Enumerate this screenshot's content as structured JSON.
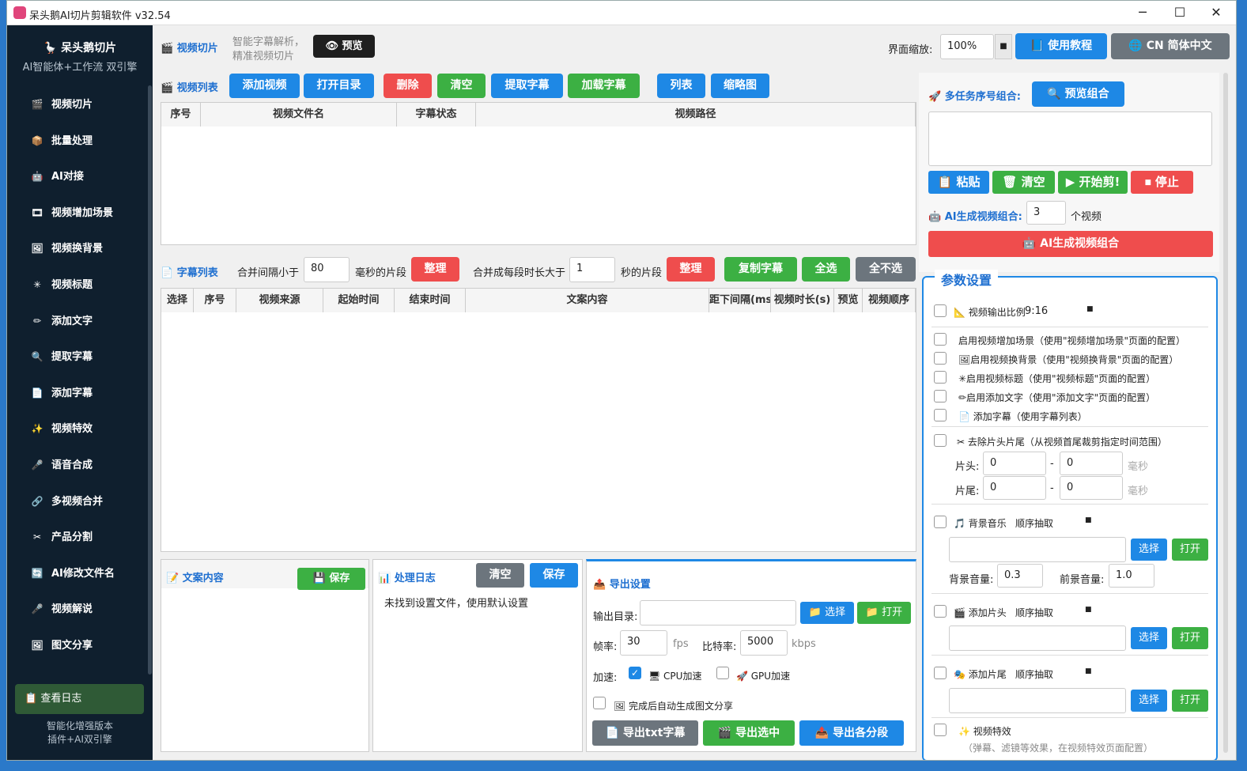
{
  "window": {
    "title": "呆头鹅AI切片剪辑软件 v32.54",
    "min": "─",
    "max": "☐",
    "close": "✕"
  },
  "sidebar": {
    "brand": "🪿 呆头鹅切片",
    "subtitle": "AI智能体+工作流 双引擎",
    "items": [
      {
        "icon": "🎬",
        "label": "视频切片"
      },
      {
        "icon": "📦",
        "label": "批量处理"
      },
      {
        "icon": "🤖",
        "label": "AI对接"
      },
      {
        "icon": "🎞",
        "label": "视频增加场景"
      },
      {
        "icon": "🖼",
        "label": "视频换背景"
      },
      {
        "icon": "✳",
        "label": "视频标题"
      },
      {
        "icon": "✏",
        "label": "添加文字"
      },
      {
        "icon": "🔍",
        "label": "提取字幕"
      },
      {
        "icon": "📄",
        "label": "添加字幕"
      },
      {
        "icon": "✨",
        "label": "视频特效"
      },
      {
        "icon": "🎤",
        "label": "语音合成"
      },
      {
        "icon": "🔗",
        "label": "多视频合并"
      },
      {
        "icon": "✂",
        "label": "产品分割"
      },
      {
        "icon": "🔄",
        "label": "AI修改文件名"
      },
      {
        "icon": "🎤",
        "label": "视频解说"
      },
      {
        "icon": "🖼",
        "label": "图文分享"
      }
    ],
    "view_log": "📋 查看日志",
    "footer1": "智能化增强版本",
    "footer2": "插件+AI双引擎"
  },
  "header": {
    "section": "🎬 视频切片",
    "desc1": "智能字幕解析，",
    "desc2": "精准视频切片",
    "preview": "👁 预览",
    "zoom_label": "界面缩放:",
    "zoom_value": "100%",
    "tutorial": "📘 使用教程",
    "language": "🌐 CN 简体中文"
  },
  "video_list": {
    "title": "🎬 视频列表",
    "buttons": [
      "添加视频",
      "打开目录",
      "删除",
      "清空",
      "提取字幕",
      "加载字幕",
      "列表",
      "缩略图"
    ],
    "columns": [
      "序号",
      "视频文件名",
      "字幕状态",
      "视频路径"
    ]
  },
  "subtitle_list": {
    "title": "📄 字幕列表",
    "merge_gap_label": "合并间隔小于",
    "merge_gap_value": "80",
    "ms_segment": "毫秒的片段",
    "tidy1": "整理",
    "merge_dur_label": "合并成每段时长大于",
    "merge_dur_value": "1",
    "sec_segment": "秒的片段",
    "tidy2": "整理",
    "copy": "复制字幕",
    "select_all": "全选",
    "select_none": "全不选",
    "columns": [
      "选择",
      "序号",
      "视频来源",
      "起始时间",
      "结束时间",
      "文案内容",
      "距下间隔(ms)",
      "视频时长(s)",
      "预览",
      "视频顺序"
    ]
  },
  "copy_panel": {
    "title": "📝 文案内容",
    "save": "💾 保存"
  },
  "log_panel": {
    "title": "📊 处理日志",
    "clear": "清空",
    "save": "保存",
    "message": "未找到设置文件，使用默认设置"
  },
  "export": {
    "title": "📤 导出设置",
    "dir_label": "输出目录:",
    "dir_value": "",
    "choose": "📁 选择",
    "open": "📁 打开",
    "fps_label": "帧率:",
    "fps_value": "30",
    "fps_unit": "fps",
    "bitrate_label": "比特率:",
    "bitrate_value": "5000",
    "bitrate_unit": "kbps",
    "accel_label": "加速:",
    "cpu": "🖥 CPU加速",
    "gpu": "🚀 GPU加速",
    "auto_share": "🖼 完成后自动生成图文分享",
    "btn_txt": "📄 导出txt字幕",
    "btn_selected": "🎬 导出选中",
    "btn_segments": "📤 导出各分段"
  },
  "right": {
    "multi_title": "🚀 多任务序号组合:",
    "preview_combo": "🔍 预览组合",
    "paste": "📋 粘贴",
    "clear": "🗑 清空",
    "start": "▶ 开始剪!",
    "stop": "⏹ 停止",
    "ai_label": "🤖 AI生成视频组合:",
    "ai_count": "3",
    "ai_unit": "个视频",
    "ai_btn": "🤖 AI生成视频组合",
    "params_title": "参数设置",
    "ratio_label": "📐 视频输出比例",
    "ratio_value": "9:16",
    "opt1": "启用视频增加场景（使用\"视频增加场景\"页面的配置）",
    "opt2": "🖼启用视频换背景（使用\"视频换背景\"页面的配置）",
    "opt3": "✳启用视频标题（使用\"视频标题\"页面的配置）",
    "opt4": "✏启用添加文字（使用\"添加文字\"页面的配置）",
    "opt5": "📄 添加字幕（使用字幕列表）",
    "trim": "✂ 去除片头片尾（从视频首尾裁剪指定时间范围）",
    "head_label": "片头:",
    "tail_label": "片尾:",
    "zero": "0",
    "dash": "-",
    "ms": "毫秒",
    "bgm": "🎵 背景音乐",
    "order": "顺序抽取",
    "choose": "选择",
    "open": "打开",
    "bg_vol_label": "背景音量:",
    "bg_vol": "0.3",
    "fg_vol_label": "前景音量:",
    "fg_vol": "1.0",
    "intro": "🎬 添加片头",
    "outro": "🎭 添加片尾",
    "effects": "✨ 视频特效",
    "effects_desc": "（弹幕、滤镜等效果，在视频特效页面配置）"
  }
}
